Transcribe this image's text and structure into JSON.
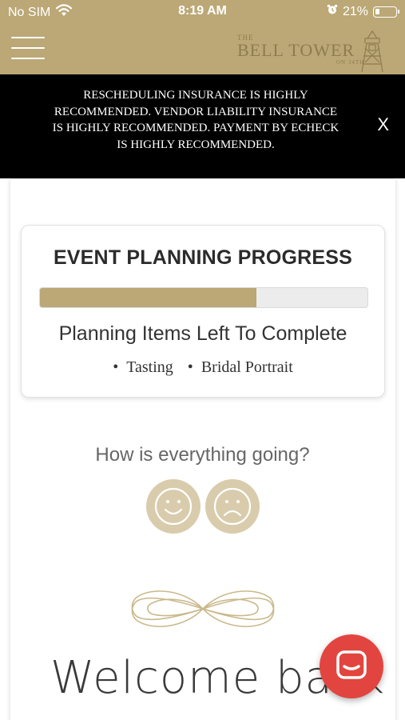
{
  "status_bar": {
    "carrier": "No SIM",
    "time": "8:19 AM",
    "battery_percent": "21%",
    "battery_level": 0.21,
    "icons": [
      "wifi-icon",
      "alarm-icon",
      "battery-icon"
    ]
  },
  "header": {
    "menu_icon": "hamburger-menu-icon",
    "logo": {
      "the": "THE",
      "name": "BELL TOWER",
      "sub": "ON 34TH"
    }
  },
  "banner": {
    "text": "RESCHEDULING INSURANCE IS HIGHLY RECOMMENDED. VENDOR LIABILITY INSURANCE IS HIGHLY RECOMMENDED. PAYMENT BY ECHECK IS HIGHLY RECOMMENDED.",
    "close_label": "X"
  },
  "progress": {
    "title": "EVENT PLANNING PROGRESS",
    "fraction": 0.66,
    "items_heading": "Planning Items Left To Complete",
    "items": [
      "Tasting",
      "Bridal Portrait"
    ]
  },
  "feedback": {
    "question": "How is everything going?",
    "options": [
      "happy-face-icon",
      "sad-face-icon"
    ]
  },
  "welcome": {
    "text": "Welcome back"
  },
  "chat": {
    "icon": "chat-icon"
  },
  "colors": {
    "brand_gold": "#bba876",
    "banner_bg": "#000000",
    "face_bg": "#d9ccac",
    "chat_red": "#e2453f"
  }
}
